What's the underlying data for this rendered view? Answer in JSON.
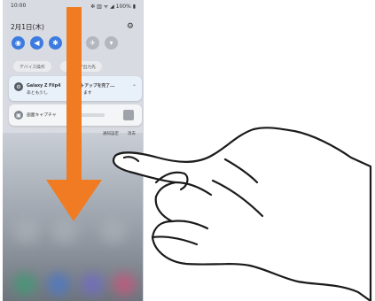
{
  "status_bar": {
    "time": "10:00",
    "icons": "✻ ▥ ᯤ ◢ 100% ▮"
  },
  "panel": {
    "date": "2月1日(木)",
    "settings_icon": "gear-icon",
    "quick_settings": [
      {
        "icon": "wifi-icon",
        "glyph": "◉",
        "state": "on"
      },
      {
        "icon": "sound-icon",
        "glyph": "◀",
        "state": "on"
      },
      {
        "icon": "bluetooth-icon",
        "glyph": "✱",
        "state": "on"
      },
      {
        "icon": "rotate-icon",
        "glyph": "⟳",
        "state": "on"
      },
      {
        "icon": "airplane-icon",
        "glyph": "✈",
        "state": "off"
      },
      {
        "icon": "flashlight-icon",
        "glyph": "▾",
        "state": "off"
      }
    ],
    "device_control_label": "デバイス操作",
    "media_output_label": "メディア出力先"
  },
  "notifications": [
    {
      "title": "Galaxy Z Flip4",
      "title_rest": "トアップを完了...",
      "body": "あとも少し",
      "body_rest": "ます",
      "icon": "gear-icon"
    },
    {
      "title": "画面キャプチャ",
      "icon": "screenshot-icon"
    }
  ],
  "actions": {
    "notification_settings": "通知設定",
    "clear": "消去"
  },
  "colors": {
    "arrow": "#f07b22",
    "toggle_on": "#3c7be0",
    "toggle_off": "#b4b8be"
  }
}
